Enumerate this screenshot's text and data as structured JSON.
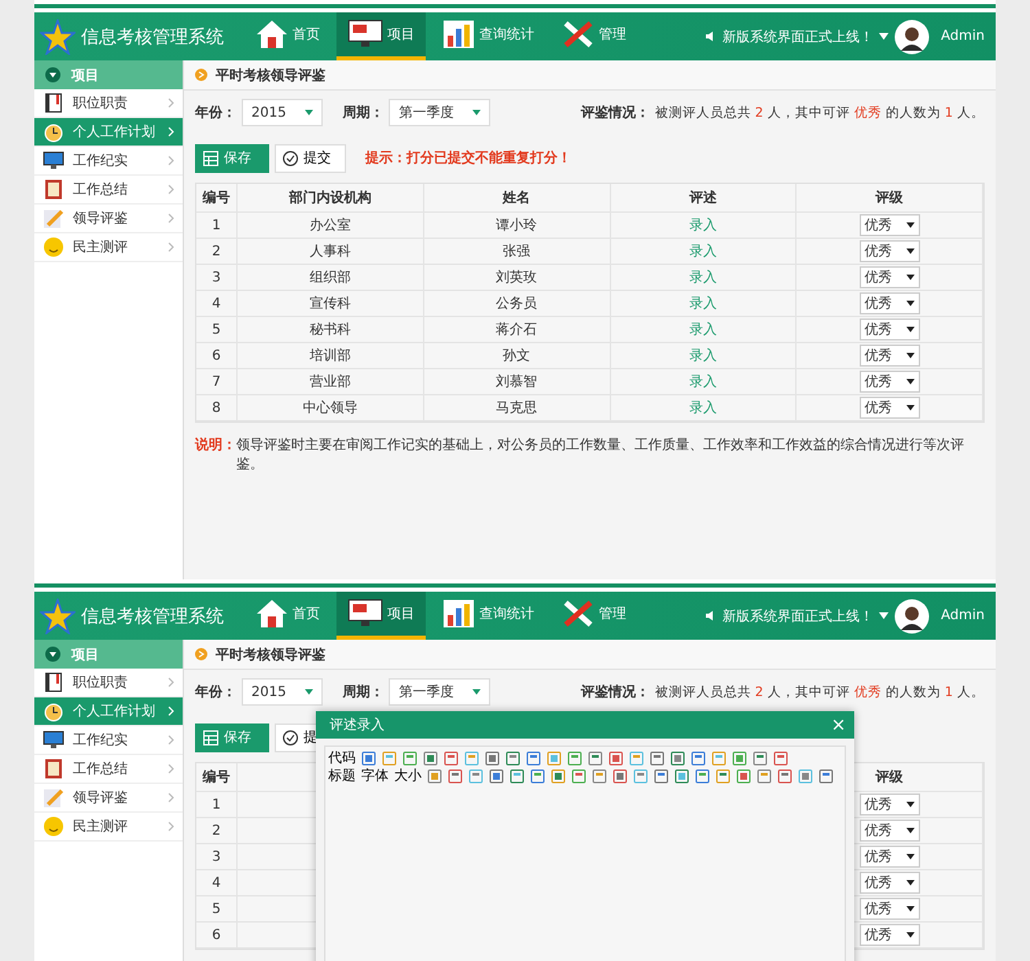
{
  "screens": [
    {
      "header": {
        "title": "信息考核管理系统",
        "nav": [
          {
            "label": "首页",
            "selected": false
          },
          {
            "label": "项目",
            "selected": true
          },
          {
            "label": "查询统计",
            "selected": false
          },
          {
            "label": "管理",
            "selected": false
          }
        ],
        "notice": "新版系统界面正式上线！",
        "user": "Admin"
      },
      "sidebar": {
        "heading": "项目",
        "items": [
          {
            "label": "职位职责",
            "selected": false
          },
          {
            "label": "个人工作计划",
            "selected": true
          },
          {
            "label": "工作纪实",
            "selected": false
          },
          {
            "label": "工作总结",
            "selected": false
          },
          {
            "label": "领导评鉴",
            "selected": false
          },
          {
            "label": "民主测评",
            "selected": false
          }
        ]
      },
      "content": {
        "breadcrumb": "平时考核领导评鉴",
        "filters": [
          {
            "label": "年份：",
            "value": "2015"
          },
          {
            "label": "周期：",
            "value": "第一季度"
          }
        ],
        "summary_label": "评鉴情况：",
        "summary": [
          {
            "text": "被测评人员总共 ",
            "kind": "plain"
          },
          {
            "text": "2",
            "kind": "highlight"
          },
          {
            "text": " 人，其中可评 ",
            "kind": "plain"
          },
          {
            "text": "优秀",
            "kind": "highlight"
          },
          {
            "text": " 的人数为 ",
            "kind": "plain"
          },
          {
            "text": "1",
            "kind": "highlight"
          },
          {
            "text": " 人。",
            "kind": "plain"
          }
        ],
        "buttons": [
          {
            "label": "保存",
            "kind": "primary"
          },
          {
            "label": "提交",
            "kind": "secondary"
          }
        ],
        "warning": "提示：打分已提交不能重复打分！",
        "columns": {
          "number": "编号",
          "department": "部门内设机构",
          "name": "姓名",
          "comment": "评述",
          "rating": "评级"
        },
        "rows": [
          {
            "number": "1",
            "department": "办公室",
            "name": "谭小玲",
            "comment": "录入",
            "rating": "优秀"
          },
          {
            "number": "2",
            "department": "人事科",
            "name": "张强",
            "comment": "录入",
            "rating": "优秀"
          },
          {
            "number": "3",
            "department": "组织部",
            "name": "刘英玫",
            "comment": "录入",
            "rating": "优秀"
          },
          {
            "number": "4",
            "department": "宣传科",
            "name": "公务员",
            "comment": "录入",
            "rating": "优秀"
          },
          {
            "number": "5",
            "department": "秘书科",
            "name": "蒋介石",
            "comment": "录入",
            "rating": "优秀"
          },
          {
            "number": "6",
            "department": "培训部",
            "name": "孙文",
            "comment": "录入",
            "rating": "优秀"
          },
          {
            "number": "7",
            "department": "营业部",
            "name": "刘慕智",
            "comment": "录入",
            "rating": "优秀"
          },
          {
            "number": "8",
            "department": "中心领导",
            "name": "马克思",
            "comment": "录入",
            "rating": "优秀"
          }
        ],
        "note_label": "说明：",
        "note": "领导评鉴时主要在审阅工作记实的基础上，对公务员的工作数量、工作质量、工作效率和工作效益的综合情况进行等次评鉴。"
      }
    },
    {
      "header": {
        "title": "信息考核管理系统",
        "nav": [
          {
            "label": "首页",
            "selected": false
          },
          {
            "label": "项目",
            "selected": true
          },
          {
            "label": "查询统计",
            "selected": false
          },
          {
            "label": "管理",
            "selected": false
          }
        ],
        "notice": "新版系统界面正式上线！",
        "user": "Admin"
      },
      "sidebar": {
        "heading": "项目",
        "items": [
          {
            "label": "职位职责",
            "selected": false
          },
          {
            "label": "个人工作计划",
            "selected": true
          },
          {
            "label": "工作纪实",
            "selected": false
          },
          {
            "label": "工作总结",
            "selected": false
          },
          {
            "label": "领导评鉴",
            "selected": false
          },
          {
            "label": "民主测评",
            "selected": false
          }
        ]
      },
      "content": {
        "breadcrumb": "平时考核领导评鉴",
        "filters": [
          {
            "label": "年份：",
            "value": "2015"
          },
          {
            "label": "周期：",
            "value": "第一季度"
          }
        ],
        "summary_label": "评鉴情况：",
        "summary": [
          {
            "text": "被测评人员总共 ",
            "kind": "plain"
          },
          {
            "text": "2",
            "kind": "highlight"
          },
          {
            "text": " 人，其中可评 ",
            "kind": "plain"
          },
          {
            "text": "优秀",
            "kind": "highlight"
          },
          {
            "text": " 的人数为 ",
            "kind": "plain"
          },
          {
            "text": "1",
            "kind": "highlight"
          },
          {
            "text": " 人。",
            "kind": "plain"
          }
        ],
        "buttons": [
          {
            "label": "保存",
            "kind": "primary"
          },
          {
            "label": "提",
            "kind": "secondary"
          }
        ],
        "columns": {
          "number": "编号",
          "rating": "评级"
        },
        "rows": [
          {
            "number": "1",
            "rating": "优秀"
          },
          {
            "number": "2",
            "rating": "优秀"
          },
          {
            "number": "3",
            "rating": "优秀"
          },
          {
            "number": "4",
            "rating": "优秀"
          },
          {
            "number": "5",
            "rating": "优秀"
          },
          {
            "number": "6",
            "rating": "优秀"
          }
        ]
      },
      "modal": {
        "title": "评述录入",
        "close": "×",
        "toolbar": [
          [
            "代码"
          ],
          [
            "标题",
            "字体",
            "大小"
          ]
        ]
      }
    }
  ]
}
